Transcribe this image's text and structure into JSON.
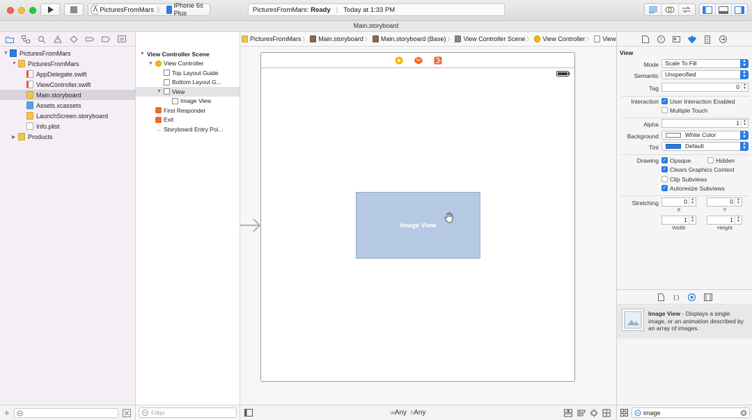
{
  "toolbar": {
    "scheme": "PicturesFromMars",
    "device": "iPhone 6s Plus",
    "status_app": "PicturesFromMars:",
    "status_state": "Ready",
    "status_time": "Today at 1:33 PM"
  },
  "window_title": "Main.storyboard",
  "navigator": {
    "items": [
      {
        "label": "PicturesFromMars",
        "level": 0,
        "kind": "project",
        "disclosure": "open"
      },
      {
        "label": "PicturesFromMars",
        "level": 1,
        "kind": "folder",
        "disclosure": "open"
      },
      {
        "label": "AppDelegate.swift",
        "level": 2,
        "kind": "swift"
      },
      {
        "label": "ViewController.swift",
        "level": 2,
        "kind": "swift"
      },
      {
        "label": "Main.storyboard",
        "level": 2,
        "kind": "storyboard",
        "selected": true
      },
      {
        "label": "Assets.xcassets",
        "level": 2,
        "kind": "assets"
      },
      {
        "label": "LaunchScreen.storyboard",
        "level": 2,
        "kind": "storyboard"
      },
      {
        "label": "Info.plist",
        "level": 2,
        "kind": "plist"
      },
      {
        "label": "Products",
        "level": 1,
        "kind": "folder",
        "disclosure": "closed"
      }
    ],
    "filter_placeholder": ""
  },
  "jumpbar": {
    "crumbs": [
      "PicturesFromMars",
      "PicturesFromMars",
      "Main.storyboard",
      "Main.storyboard (Base)",
      "View Controller Scene",
      "View Controller",
      "View"
    ]
  },
  "outline": {
    "items": [
      {
        "label": "View Controller Scene",
        "level": 0,
        "bold": true,
        "disclosure": "open"
      },
      {
        "label": "View Controller",
        "level": 1,
        "disclosure": "open",
        "icon": "vc"
      },
      {
        "label": "Top Layout Guide",
        "level": 2,
        "icon": "box"
      },
      {
        "label": "Bottom Layout G...",
        "level": 2,
        "icon": "box"
      },
      {
        "label": "View",
        "level": 2,
        "disclosure": "open",
        "icon": "box",
        "selected": true
      },
      {
        "label": "Image View",
        "level": 3,
        "icon": "img"
      },
      {
        "label": "First Responder",
        "level": 1,
        "icon": "responder"
      },
      {
        "label": "Exit",
        "level": 1,
        "icon": "exit"
      },
      {
        "label": "Storyboard Entry Poi...",
        "level": 1,
        "icon": "arrow"
      }
    ],
    "filter_placeholder": "Filter"
  },
  "canvas": {
    "image_view_label": "Image View",
    "size_class_w": "w",
    "size_class_w_value": "Any",
    "size_class_h": "h",
    "size_class_h_value": "Any"
  },
  "inspector": {
    "section_title": "View",
    "mode_label": "Mode",
    "mode_value": "Scale To Fill",
    "semantic_label": "Semantic",
    "semantic_value": "Unspecified",
    "tag_label": "Tag",
    "tag_value": "0",
    "interaction_label": "Interaction",
    "user_interaction": "User Interaction Enabled",
    "multiple_touch": "Multiple Touch",
    "alpha_label": "Alpha",
    "alpha_value": "1",
    "background_label": "Background",
    "background_value": "White Color",
    "tint_label": "Tint",
    "tint_value": "Default",
    "drawing_label": "Drawing",
    "opaque": "Opaque",
    "hidden": "Hidden",
    "clears_graphics": "Clears Graphics Context",
    "clip_subviews": "Clip Subviews",
    "autoresize": "Autoresize Subviews",
    "stretching_label": "Stretching",
    "stretch_x": "0",
    "stretch_y": "0",
    "stretch_w": "1",
    "stretch_h": "1",
    "x_label": "X",
    "y_label": "Y",
    "width_label": "Width",
    "height_label": "Height"
  },
  "library": {
    "title": "Image View",
    "description": " - Displays a single image, or an animation described by an array of images.",
    "search_value": "image"
  },
  "colors": {
    "accent": "#2a7de1",
    "nav_bg": "#f5eff5",
    "image_view_fill": "#b6c9e4"
  }
}
